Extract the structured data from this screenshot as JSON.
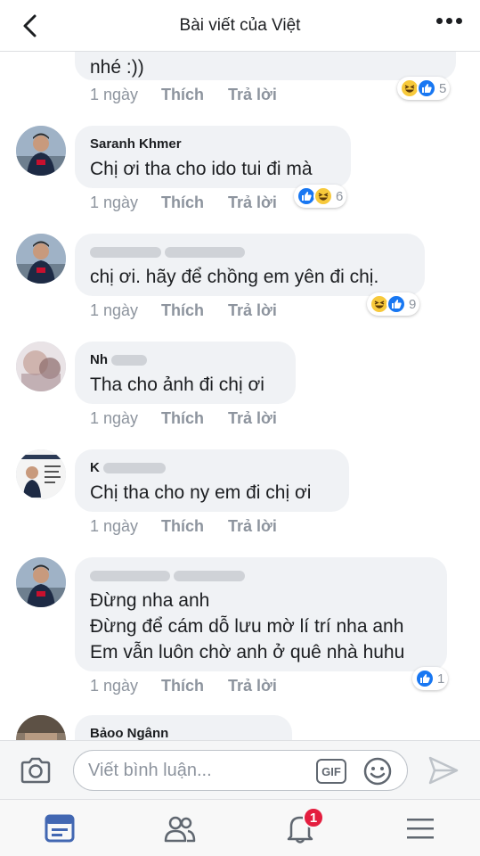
{
  "header": {
    "title": "Bài viết của Việt"
  },
  "labels": {
    "like": "Thích",
    "reply": "Trả lời"
  },
  "comments": [
    {
      "author": "",
      "text": "nhé :))",
      "time": "1 ngày",
      "reactions": [
        "haha",
        "like"
      ],
      "count": "5"
    },
    {
      "author": "Saranh Khmer",
      "text": "Chị ơi tha cho ido tui đi mà",
      "time": "1 ngày",
      "reactions": [
        "like",
        "haha"
      ],
      "count": "6"
    },
    {
      "author": "",
      "text": "chị ơi. hãy để chồng em yên đi chị.",
      "time": "1 ngày",
      "reactions": [
        "haha",
        "like"
      ],
      "count": "9"
    },
    {
      "author": "Nh",
      "text": "Tha cho ảnh đi chị ơi",
      "time": "1 ngày",
      "reactions": [],
      "count": ""
    },
    {
      "author": "K",
      "text": "Chị tha cho ny em đi chị ơi",
      "time": "1 ngày",
      "reactions": [],
      "count": ""
    },
    {
      "author": "",
      "text": "Đừng nha anh\nĐừng để cám dỗ lưu mờ lí trí nha anh\nEm vẫn luôn chờ anh ở quê nhà huhu",
      "time": "1 ngày",
      "reactions": [
        "like"
      ],
      "count": "1"
    },
    {
      "author": "Bảoo Ngânn",
      "text": "",
      "time": "",
      "reactions": [],
      "count": ""
    }
  ],
  "composer": {
    "placeholder": "Viết bình luận...",
    "gif_label": "GIF"
  },
  "nav": {
    "notifications_badge": "1"
  },
  "colors": {
    "like": "#1877f2",
    "haha": "#f7c93b",
    "badge": "#e41e3f",
    "active_tab": "#4267b2"
  },
  "icons": [
    "back-arrow-icon",
    "more-dots-icon",
    "camera-icon",
    "gif-icon",
    "smiley-icon",
    "send-icon",
    "news-feed-icon",
    "friends-icon",
    "bell-icon",
    "menu-icon",
    "like-icon",
    "haha-icon"
  ]
}
